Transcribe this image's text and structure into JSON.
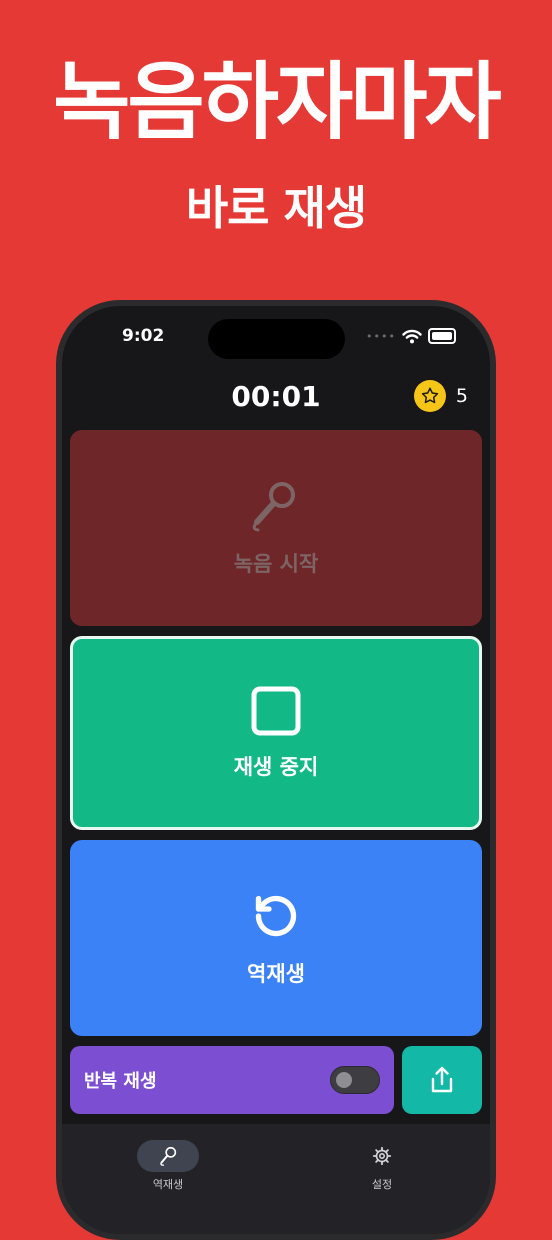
{
  "promo": {
    "headline": "녹음하자마자",
    "subline": "바로 재생"
  },
  "status_bar": {
    "time": "9:02"
  },
  "header": {
    "timer": "00:01",
    "star_count": "5"
  },
  "buttons": {
    "record_label": "녹음 시작",
    "stop_label": "재생 중지",
    "reverse_label": "역재생"
  },
  "repeat": {
    "label": "반복 재생",
    "enabled": false
  },
  "tabs": [
    {
      "label": "역재생",
      "icon": "mic-icon",
      "selected": true
    },
    {
      "label": "설정",
      "icon": "gear-icon",
      "selected": false
    }
  ],
  "colors": {
    "background": "#e53935",
    "record": "#6f2629",
    "stop": "#12b885",
    "reverse": "#3b82f6",
    "repeat": "#7c4fd2",
    "share": "#14b8a6",
    "star": "#f5c518"
  }
}
